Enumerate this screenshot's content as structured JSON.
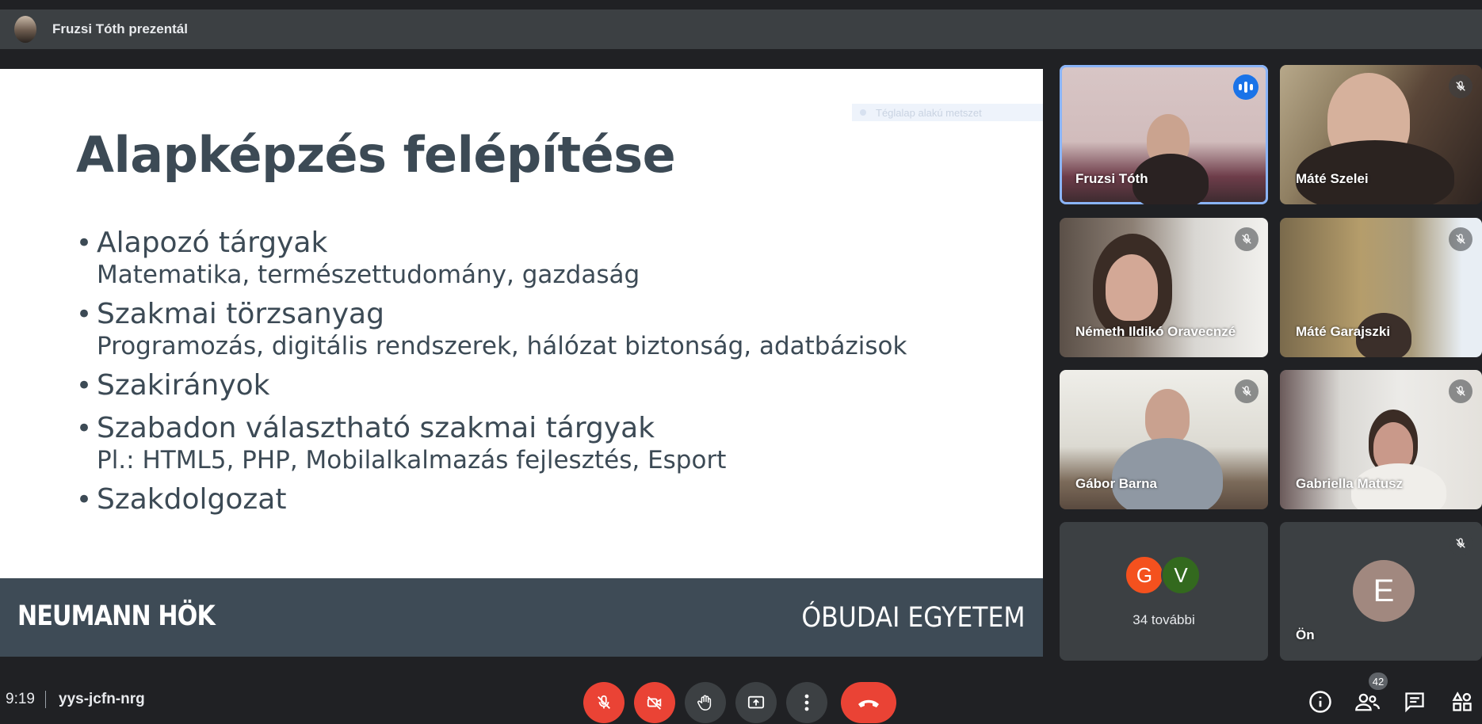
{
  "presenter_bar": {
    "label": "Fruzsi Tóth prezentál"
  },
  "slide": {
    "tooltip": "Téglalap alakú metszet",
    "title": "Alapképzés felépítése",
    "bullets": [
      {
        "main": "Alapozó tárgyak",
        "sub": "Matematika, természettudomány, gazdaság"
      },
      {
        "main": "Szakmai törzsanyag",
        "sub": "Programozás, digitális rendszerek, hálózat biztonság, adatbázisok"
      },
      {
        "main": "Szakirányok",
        "sub": ""
      },
      {
        "main": "Szabadon választható szakmai tárgyak",
        "sub": "Pl.: HTML5, PHP, Mobilalkalmazás fejlesztés, Esport"
      },
      {
        "main": "Szakdolgozat",
        "sub": ""
      }
    ],
    "bullet_char": "•",
    "footer_left": "NEUMANN HÖK",
    "footer_right": "ÓBUDAI EGYETEM"
  },
  "participants": [
    {
      "name": "Fruzsi Tóth",
      "state": "speaking"
    },
    {
      "name": "Máté Szelei",
      "state": "muted"
    },
    {
      "name": "Németh Ildikó Oravecnzé",
      "state": "muted"
    },
    {
      "name": "Máté Garajszki",
      "state": "muted"
    },
    {
      "name": "Gábor Barna",
      "state": "muted"
    },
    {
      "name": "Gabriella Matusz",
      "state": "muted"
    }
  ],
  "more_tile": {
    "avatars": [
      {
        "letter": "G",
        "color": "#f4511e"
      },
      {
        "letter": "V",
        "color": "#33691e"
      }
    ],
    "label": "34 további"
  },
  "self_tile": {
    "name": "Ön",
    "letter": "E",
    "color": "#a1887f"
  },
  "bottom_bar": {
    "time": "9:19",
    "meeting_code": "yys-jcfn-nrg",
    "people_count": "42"
  },
  "colors": {
    "accent": "#8ab4f8",
    "danger": "#ea4335",
    "speaking": "#1a73e8"
  }
}
